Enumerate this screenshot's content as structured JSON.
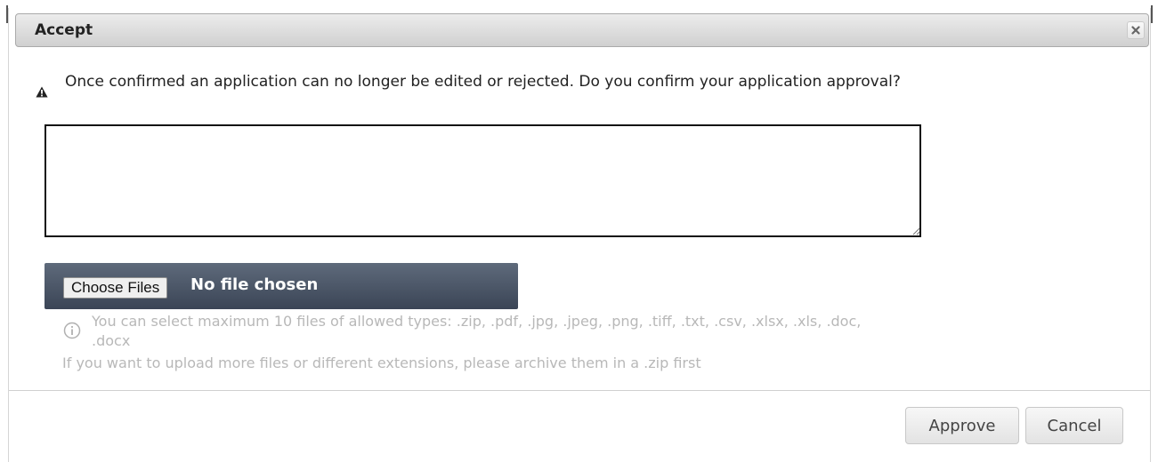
{
  "dialog": {
    "title": "Accept",
    "close_icon": "close-icon",
    "warning": {
      "icon": "warning-triangle-icon",
      "text": "Once confirmed an application can no longer be edited or rejected. Do you confirm your application approval?"
    },
    "comment": {
      "value": "",
      "placeholder": ""
    },
    "file_input": {
      "button_label": "Choose Files",
      "status": "No file chosen"
    },
    "hint": {
      "icon": "info-icon",
      "line1": "You can select maximum 10 files of allowed types: .zip, .pdf, .jpg, .jpeg, .png, .tiff, .txt, .csv, .xlsx, .xls, .doc,",
      "line2": ".docx",
      "line3": "If you want to upload more files or different extensions, please archive them in a .zip first"
    },
    "buttons": {
      "approve": "Approve",
      "cancel": "Cancel"
    }
  }
}
